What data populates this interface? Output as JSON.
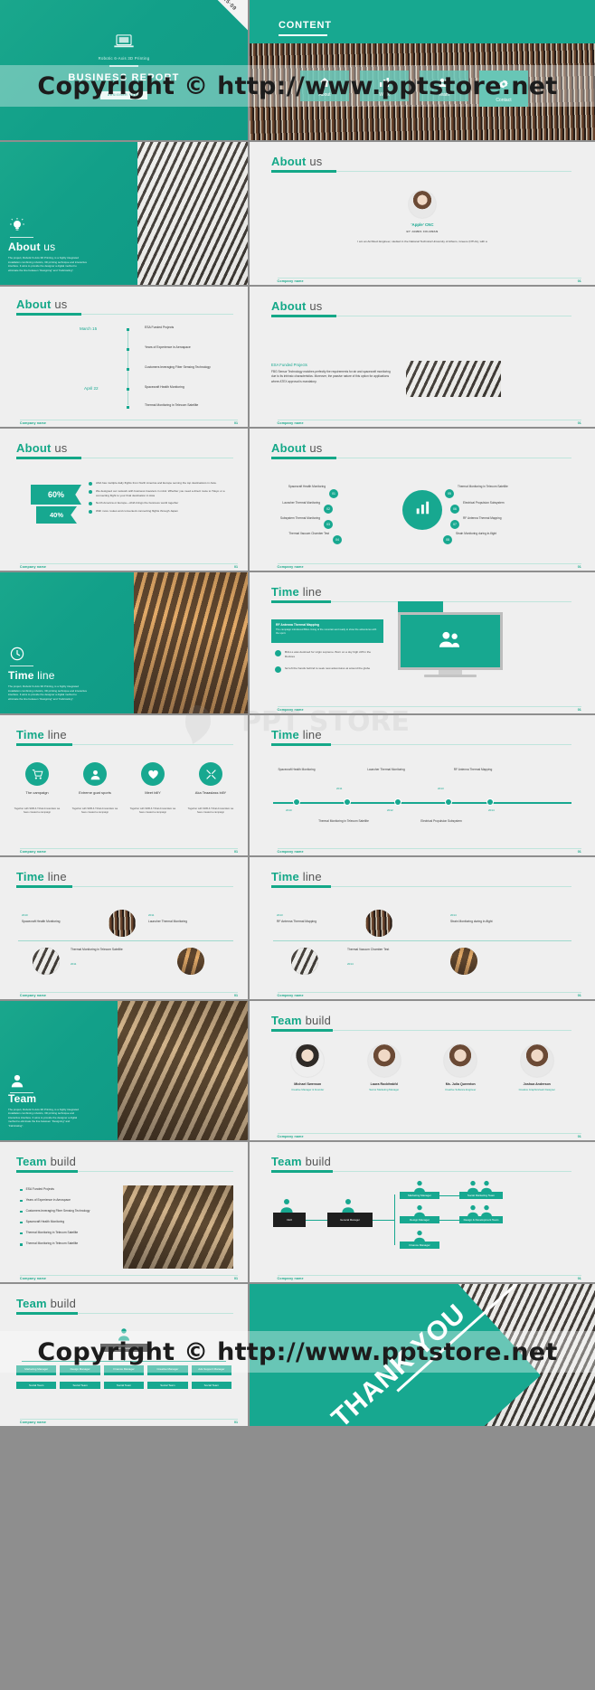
{
  "theme": {
    "accent": "#17a890",
    "accent_dark": "#12a089",
    "bg": "#efefef",
    "gap": "#8e8e8e"
  },
  "watermark": {
    "text": "Copyright © http://www.pptstore.net",
    "logo_text": "PPT STORE"
  },
  "common": {
    "footer_label": "Company name",
    "footer_page": "01",
    "about_title": "About",
    "about_title_light": "us",
    "time_title": "Time",
    "time_title_light": "line",
    "team_title": "Team",
    "team_title_light": "build"
  },
  "slides": [
    {
      "id": "cover",
      "ribbon": "2015·09",
      "icon": "laptop-icon",
      "subtitle": "Robotic 6-Axis 3D Printing",
      "heading": "BUSINESS REPORT",
      "button": "DESIGNER NAME"
    },
    {
      "id": "content",
      "title": "CONTENT",
      "nav": [
        {
          "label": "About",
          "icon": "home-icon",
          "active": false
        },
        {
          "label": "Work",
          "icon": "chart-icon",
          "active": false
        },
        {
          "label": "Team",
          "icon": "users-icon",
          "active": false
        },
        {
          "label": "Contact",
          "icon": "gear-icon",
          "active": true
        }
      ]
    },
    {
      "id": "about-section",
      "icon": "bulb-icon",
      "heading": "About",
      "heading_light": "us",
      "body": "The project, Robotic 6-Axis 3D Printing, is a highly integrated installation combining robotics, 3D printing technique and interactive interface. It aims to provide the designer a digital method to eliminate the line between “Designing” and “Fabricating”."
    },
    {
      "id": "about-profile",
      "name": "'Apple' CNC",
      "by": "BY JAMES COLEMAN",
      "body": "I am an Architect Engineer, studied in the National Technical University of Athens, Greece (NTUA), with a"
    },
    {
      "id": "about-timeline",
      "dates": [
        "March 15",
        "April 22"
      ],
      "items": [
        "ESA Funded Projects",
        "Years of Experience in Aerospace",
        "Customers leveraging Fiber Sensing  Technology",
        "Spacecraft Health Monitoring",
        "Thermal Monitoring  in Telecom Satellite",
        "Thermal Monitoring  in Telecom Satellite"
      ]
    },
    {
      "id": "about-text-photo",
      "kicker": "ESA Funded Projects",
      "body": "FBG Sensor Technology matches perfectly the requirements for air and spacecraft monitoring due to its intrinsic characteristics. Moreover, the passive nature of this option for applications where ATEX approval is mandatory."
    },
    {
      "id": "about-stats",
      "stats": [
        {
          "value": "60%"
        },
        {
          "value": "40%"
        }
      ],
      "bullets": [
        "ANA has multiple daily flights from North America and Europe serving the top destinations in Asia.",
        "We designed our network  with business travelers in mind. Whether you need a direct route to Tokyo or a connecting flight to your final destination in Asia",
        "North America or Europe—ANA brings the business world together",
        "With more routes and convenient connecting flights through Japan"
      ]
    },
    {
      "id": "about-hub",
      "center_icon": "chart-icon",
      "left": [
        "Spacecraft Health Monitoring",
        "Launcher Thermal Monitoring",
        "Subsystem Thermal Monitoring",
        "Thermal Vacuum Chamber Test"
      ],
      "right": [
        "Thermal Monitoring  in Telecom Satellite",
        "Electrical Propulsion Subsystem",
        "RF Antenna Thermal Mapping",
        "Strain Monitoring  during in-flight"
      ]
    },
    {
      "id": "time-section",
      "icon": "clock-icon",
      "heading": "Time",
      "heading_light": "line",
      "body": "The project, Robotic 6-Axis 3D Printing, is a highly integrated installation combining robotics, 3D printing technique and interactive interface. It aims to provide the designer a digital method to eliminate the line between “Designing” and “Fabricating”."
    },
    {
      "id": "time-device",
      "banner_title": "RF Antenna  Thermal Mapping",
      "banner_body": "The campaign introduced BALL Using of the mountain and ready to show the adventures with the sport.",
      "screen_icon": "users-icon",
      "bullets": [
        "BULLs was destined for virgin supreme. Born on a sky high cliff in the Rockies",
        "far left the hands behind to seek new adventures at around the globe"
      ]
    },
    {
      "id": "time-icons",
      "cards": [
        {
          "icon": "cart-icon",
          "title": "The campaign",
          "body": "Together  with SDB & Tribal Amsterdam we have created a campaign"
        },
        {
          "icon": "user-icon",
          "title": "Extreme goat sports",
          "body": "Together  with SDB & Tribal Amsterdam we have created a campaign"
        },
        {
          "icon": "heart-icon",
          "title": "Meet billY",
          "body": "Together  with SDB & Tribal Amsterdam we have created a campaign"
        },
        {
          "icon": "tools-icon",
          "title": "Aka Teaaslass billY",
          "body": "Together  with SDB & Tribal Amsterdam we have created a campaign"
        }
      ]
    },
    {
      "id": "time-axis",
      "top_labels": [
        "Spacecraft Health Monitoring",
        "Launcher Thermal Monitoring",
        "RF Antenna Thermal Mapping"
      ],
      "bottom_labels": [
        "Thermal Monitoring  in Telecom Satellite",
        "Electrical Propulsion Subsystem"
      ],
      "years_top": [
        "2011",
        "2013"
      ],
      "years_bottom": [
        "2010",
        "2012",
        "2014"
      ]
    },
    {
      "id": "time-photos-left",
      "entries": [
        {
          "year": "2010",
          "label": "Spacecraft Health Monitoring"
        },
        {
          "year": "2011",
          "label": "Launcher Thermal Monitoring"
        },
        {
          "year": "2011",
          "label": "Thermal Monitoring  in Telecom Satellite"
        }
      ]
    },
    {
      "id": "time-photos-right",
      "entries": [
        {
          "year": "2013",
          "label": "RF Antenna Thermal Mapping"
        },
        {
          "year": "2014",
          "label": "Thermal Vacuum Chamber Test"
        },
        {
          "year": "2014",
          "label": "Strain Monitoring  during in-flight"
        }
      ]
    },
    {
      "id": "team-section",
      "icon": "user-icon",
      "heading": "Team",
      "body": "The project, Robotic 6-Axis 3D Printing, is a highly integrated installation combining robotics, 3D printing technique and interactive interface. It aims to provide the designer a digital method to eliminate the line between “Designing” and “Fabricating”."
    },
    {
      "id": "team-members",
      "members": [
        {
          "name": "Michael Swenson",
          "role": "Creative Manager & Founder",
          "variant": "m"
        },
        {
          "name": "Laura Rockfeakfd",
          "role": "Senior Marketing Manager",
          "variant": "f"
        },
        {
          "name": "Ms. Julia Queenton",
          "role": "Creative Software Engineer",
          "variant": "f"
        },
        {
          "name": "Joshua Anderson",
          "role": "Creative Graphics/web Designer",
          "variant": "f"
        }
      ]
    },
    {
      "id": "team-list-photo",
      "items": [
        "ESA Funded Projects",
        "Years of Experience in Aerospace",
        "Customers leveraging Fiber Sensing  Technology",
        "Spacecraft Health Monitoring",
        "Thermal Monitoring  in Telecom Satellite",
        "Thermal Monitoring  in Telecom Satellite"
      ]
    },
    {
      "id": "team-org-1",
      "nodes": {
        "root": "CEO",
        "second": "General Manager",
        "branches": [
          "Marketing Manager",
          "Design Manager",
          "Finance Manager"
        ],
        "leaves": [
          "Social Marketing Team",
          "Design & Development Team"
        ]
      }
    },
    {
      "id": "team-org-2",
      "root": "General Manager",
      "row1": [
        "Marketing Manager",
        "Design Manager",
        "Finance Manager",
        "Creative Manager",
        "Ads Support Manager"
      ],
      "row2": [
        "Social Team",
        "Social Team",
        "Social Team",
        "Social Team",
        "Social Team"
      ]
    },
    {
      "id": "thank-you",
      "text": "THANK YOU"
    }
  ]
}
